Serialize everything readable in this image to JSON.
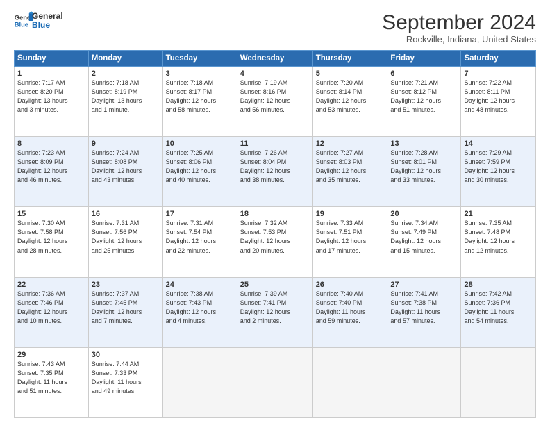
{
  "logo": {
    "line1": "General",
    "line2": "Blue",
    "icon_color": "#1a6bb5"
  },
  "title": "September 2024",
  "subtitle": "Rockville, Indiana, United States",
  "header": {
    "days": [
      "Sunday",
      "Monday",
      "Tuesday",
      "Wednesday",
      "Thursday",
      "Friday",
      "Saturday"
    ]
  },
  "weeks": [
    [
      {
        "day": "1",
        "lines": [
          "Sunrise: 7:17 AM",
          "Sunset: 8:20 PM",
          "Daylight: 13 hours",
          "and 3 minutes."
        ]
      },
      {
        "day": "2",
        "lines": [
          "Sunrise: 7:18 AM",
          "Sunset: 8:19 PM",
          "Daylight: 13 hours",
          "and 1 minute."
        ]
      },
      {
        "day": "3",
        "lines": [
          "Sunrise: 7:18 AM",
          "Sunset: 8:17 PM",
          "Daylight: 12 hours",
          "and 58 minutes."
        ]
      },
      {
        "day": "4",
        "lines": [
          "Sunrise: 7:19 AM",
          "Sunset: 8:16 PM",
          "Daylight: 12 hours",
          "and 56 minutes."
        ]
      },
      {
        "day": "5",
        "lines": [
          "Sunrise: 7:20 AM",
          "Sunset: 8:14 PM",
          "Daylight: 12 hours",
          "and 53 minutes."
        ]
      },
      {
        "day": "6",
        "lines": [
          "Sunrise: 7:21 AM",
          "Sunset: 8:12 PM",
          "Daylight: 12 hours",
          "and 51 minutes."
        ]
      },
      {
        "day": "7",
        "lines": [
          "Sunrise: 7:22 AM",
          "Sunset: 8:11 PM",
          "Daylight: 12 hours",
          "and 48 minutes."
        ]
      }
    ],
    [
      {
        "day": "8",
        "lines": [
          "Sunrise: 7:23 AM",
          "Sunset: 8:09 PM",
          "Daylight: 12 hours",
          "and 46 minutes."
        ]
      },
      {
        "day": "9",
        "lines": [
          "Sunrise: 7:24 AM",
          "Sunset: 8:08 PM",
          "Daylight: 12 hours",
          "and 43 minutes."
        ]
      },
      {
        "day": "10",
        "lines": [
          "Sunrise: 7:25 AM",
          "Sunset: 8:06 PM",
          "Daylight: 12 hours",
          "and 40 minutes."
        ]
      },
      {
        "day": "11",
        "lines": [
          "Sunrise: 7:26 AM",
          "Sunset: 8:04 PM",
          "Daylight: 12 hours",
          "and 38 minutes."
        ]
      },
      {
        "day": "12",
        "lines": [
          "Sunrise: 7:27 AM",
          "Sunset: 8:03 PM",
          "Daylight: 12 hours",
          "and 35 minutes."
        ]
      },
      {
        "day": "13",
        "lines": [
          "Sunrise: 7:28 AM",
          "Sunset: 8:01 PM",
          "Daylight: 12 hours",
          "and 33 minutes."
        ]
      },
      {
        "day": "14",
        "lines": [
          "Sunrise: 7:29 AM",
          "Sunset: 7:59 PM",
          "Daylight: 12 hours",
          "and 30 minutes."
        ]
      }
    ],
    [
      {
        "day": "15",
        "lines": [
          "Sunrise: 7:30 AM",
          "Sunset: 7:58 PM",
          "Daylight: 12 hours",
          "and 28 minutes."
        ]
      },
      {
        "day": "16",
        "lines": [
          "Sunrise: 7:31 AM",
          "Sunset: 7:56 PM",
          "Daylight: 12 hours",
          "and 25 minutes."
        ]
      },
      {
        "day": "17",
        "lines": [
          "Sunrise: 7:31 AM",
          "Sunset: 7:54 PM",
          "Daylight: 12 hours",
          "and 22 minutes."
        ]
      },
      {
        "day": "18",
        "lines": [
          "Sunrise: 7:32 AM",
          "Sunset: 7:53 PM",
          "Daylight: 12 hours",
          "and 20 minutes."
        ]
      },
      {
        "day": "19",
        "lines": [
          "Sunrise: 7:33 AM",
          "Sunset: 7:51 PM",
          "Daylight: 12 hours",
          "and 17 minutes."
        ]
      },
      {
        "day": "20",
        "lines": [
          "Sunrise: 7:34 AM",
          "Sunset: 7:49 PM",
          "Daylight: 12 hours",
          "and 15 minutes."
        ]
      },
      {
        "day": "21",
        "lines": [
          "Sunrise: 7:35 AM",
          "Sunset: 7:48 PM",
          "Daylight: 12 hours",
          "and 12 minutes."
        ]
      }
    ],
    [
      {
        "day": "22",
        "lines": [
          "Sunrise: 7:36 AM",
          "Sunset: 7:46 PM",
          "Daylight: 12 hours",
          "and 10 minutes."
        ]
      },
      {
        "day": "23",
        "lines": [
          "Sunrise: 7:37 AM",
          "Sunset: 7:45 PM",
          "Daylight: 12 hours",
          "and 7 minutes."
        ]
      },
      {
        "day": "24",
        "lines": [
          "Sunrise: 7:38 AM",
          "Sunset: 7:43 PM",
          "Daylight: 12 hours",
          "and 4 minutes."
        ]
      },
      {
        "day": "25",
        "lines": [
          "Sunrise: 7:39 AM",
          "Sunset: 7:41 PM",
          "Daylight: 12 hours",
          "and 2 minutes."
        ]
      },
      {
        "day": "26",
        "lines": [
          "Sunrise: 7:40 AM",
          "Sunset: 7:40 PM",
          "Daylight: 11 hours",
          "and 59 minutes."
        ]
      },
      {
        "day": "27",
        "lines": [
          "Sunrise: 7:41 AM",
          "Sunset: 7:38 PM",
          "Daylight: 11 hours",
          "and 57 minutes."
        ]
      },
      {
        "day": "28",
        "lines": [
          "Sunrise: 7:42 AM",
          "Sunset: 7:36 PM",
          "Daylight: 11 hours",
          "and 54 minutes."
        ]
      }
    ],
    [
      {
        "day": "29",
        "lines": [
          "Sunrise: 7:43 AM",
          "Sunset: 7:35 PM",
          "Daylight: 11 hours",
          "and 51 minutes."
        ]
      },
      {
        "day": "30",
        "lines": [
          "Sunrise: 7:44 AM",
          "Sunset: 7:33 PM",
          "Daylight: 11 hours",
          "and 49 minutes."
        ]
      },
      {
        "day": "",
        "lines": []
      },
      {
        "day": "",
        "lines": []
      },
      {
        "day": "",
        "lines": []
      },
      {
        "day": "",
        "lines": []
      },
      {
        "day": "",
        "lines": []
      }
    ]
  ]
}
